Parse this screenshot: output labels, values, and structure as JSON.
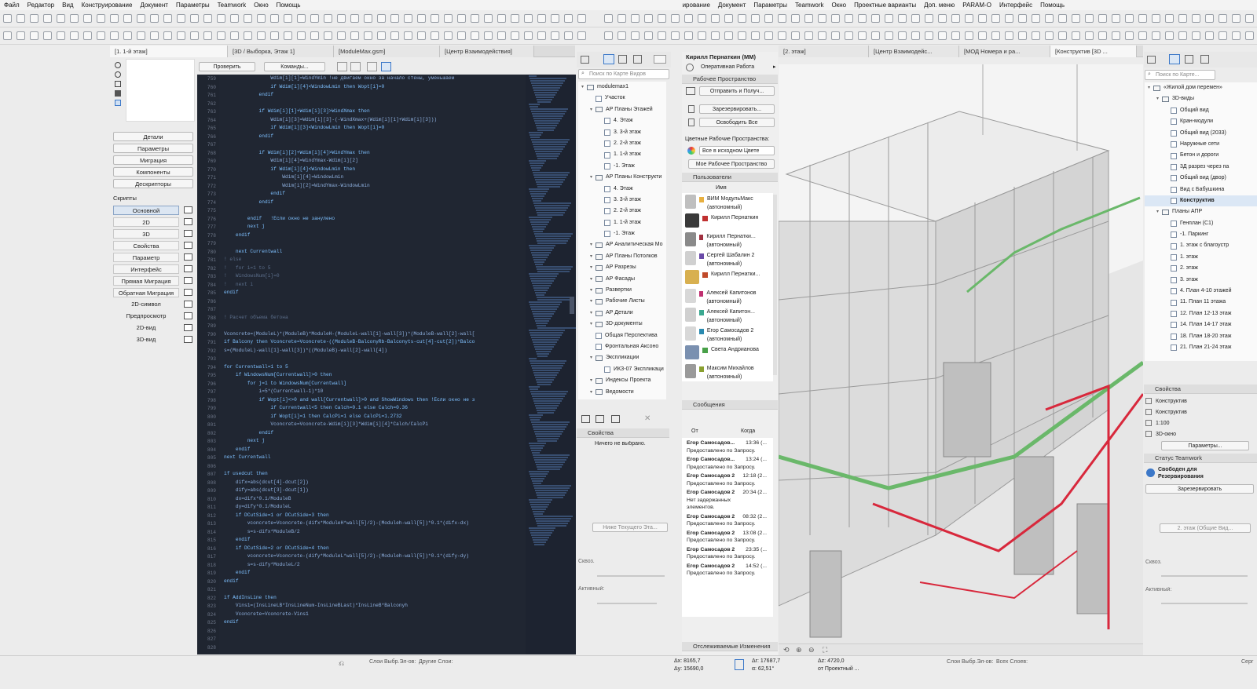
{
  "menu_left": [
    "Файл",
    "Редактор",
    "Вид",
    "Конструирование",
    "Документ",
    "Параметры",
    "Teamwork",
    "Окно",
    "Помощь"
  ],
  "menu_right": [
    "ирование",
    "Документ",
    "Параметры",
    "Teamwork",
    "Окно",
    "Проектные варианты",
    "Доп. меню",
    "PARAM-O",
    "Интерфейс",
    "Помощь"
  ],
  "left_tabs": [
    "[1. 1-й этаж]",
    "[3D / Выборка, Этаж 1]",
    "[ModuleMax.gsm]",
    "[Центр Взаимодействия]"
  ],
  "right_tabs": [
    "[2. этаж]",
    "[Центр Взаимодейс...",
    "[МОД Номера и ра...",
    "[Конструктив [3D ..."
  ],
  "gdl": {
    "check_button": "Проверить",
    "commands_button": "Команды...",
    "buttons": [
      "Детали",
      "Параметры",
      "Миграция",
      "Компоненты",
      "Дескрипторы"
    ],
    "scripts_label": "Скрипты",
    "scripts": [
      "Основной",
      "2D",
      "3D",
      "Свойства",
      "Параметр",
      "Интерфейс",
      "Прямая Миграция",
      "Обратная Миграция",
      "2D-символ",
      "Предпросмотр",
      "2D-вид",
      "3D-вид"
    ]
  },
  "code": {
    "line_numbers": [
      "759",
      "760",
      "761",
      "762",
      "763",
      "764",
      "765",
      "766",
      "767",
      "768",
      "769",
      "770",
      "771",
      "772",
      "773",
      "774",
      "775",
      "776",
      "777",
      "778",
      "779",
      "780",
      "781",
      "782",
      "783",
      "784",
      "785",
      "786",
      "787",
      "788",
      "789",
      "790",
      "791",
      "792",
      "793",
      "794",
      "795",
      "796",
      "797",
      "798",
      "799",
      "800",
      "801",
      "802",
      "803",
      "804",
      "805",
      "806",
      "807",
      "808",
      "809",
      "810",
      "811",
      "812",
      "813",
      "814",
      "815",
      "816",
      "817",
      "818",
      "819",
      "820",
      "821",
      "822",
      "823",
      "824",
      "825",
      "826",
      "827",
      "828"
    ],
    "lines": [
      "                Wdim[i][1]=WindYmin !не двигаем окно за начало стены, уменьшаем",
      "                if Wdim[i][4]<WindowLmin then Wopt[i]=0",
      "            endif",
      "",
      "            if Wdim[i][1]+Wdim[i][3]>WindXmax then",
      "                Wdim[i][3]=Wdim[i][3]-(-WindXmax+(Wdim[i][1]+Wdim[i][3]))",
      "                if Wdim[i][3]<WindowLmin then Wopt[i]=0",
      "            endif",
      "",
      "            if Wdim[i][2]+Wdim[i][4]>WindYmax then",
      "                Wdim[i][4]=WindYmax-Wdim[i][2]",
      "                if Wdim[i][4]<WindowLmin then",
      "                    Wdim[i][4]=WindowLmin",
      "                    Wdim[i][2]=WindYmax-WindowLmin",
      "                endif",
      "            endif",
      "",
      "        endif   !Если окно не занулено",
      "        next j",
      "    endif",
      "",
      "    next Currentwall",
      "! else",
      "!   for i=1 to 5",
      "!   WindowsNum[i]=0",
      "!   next i",
      "endif",
      "",
      "",
      "! Расчет объема бетона",
      "",
      "Vconcrete=(ModuleL)*(ModuleB)*ModuleH-(ModuleL-wall[1]-wall[3])*(ModuleB-wall[2]-wall[",
      "if Balcony then Vconcrete=Vconcrete-((ModuleB-BalconyRb-Balconyts-cut[4]-cut[2])*Balco",
      "s=(ModuleL)-wall[1]-wall[3])*((ModuleB)-wall[2]-wall[4])",
      "",
      "for Currentwall=1 to 5",
      "    if WindowsNum[Currentwall]>0 then",
      "        for j=1 to WindowsNum[Currentwall]",
      "            i=5*(Currentwall-1)*10",
      "            if Wopt[i]<>0 and wall[Currentwall]>0 and ShowWindows then !Если окно не з",
      "                if Currentwall<5 then Calch=0.1 else Calch=0.36",
      "                if Wopt[i]=1 then CalcPi=1 else CalcPi=1.2732",
      "                Vconcrete=Vconcrete-Wdim[i][3]*Wdim[i][4]*Calch/CalcPi",
      "            endif",
      "        next j",
      "    endif",
      "next Currentwall",
      "",
      "if usedcut then",
      "    difx=abs(dcut[4]-dcut[2])",
      "    dify=abs(dcut[3]-dcut[1])",
      "    dx=difx*0.1/ModuleB",
      "    dy=dify*0.1/ModuleL",
      "    if DCutSide=1 or DCutSide=3 then",
      "        vconcrete=Vconcrete-(difx*ModuleH*wall[5]/2)-(Moduleh-wall[5])*0.1*(difx-dx)",
      "        s=s-difx*ModuleB/2",
      "    endif",
      "    if DCutSide=2 or DCutSide=4 then",
      "        vconcrete=Vconcrete-(dify*ModuleL*wall[5]/2)-(Moduleh-wall[5])*0.1*(dify-dy)",
      "        s=s-dify*ModuleL/2",
      "    endif",
      "endif",
      "",
      "if AddInsLine then",
      "    Vins1=(InsLineLB*InsLineNum-InsLineBLast)*InsLineB*Balconyh",
      "    Vconcrete=Vconcrete-Vins1",
      "endif",
      "",
      ""
    ]
  },
  "navigator": {
    "search_placeholder": "Поиск по Карте Видов",
    "items": [
      {
        "label": "modulemax1",
        "indent": 0,
        "type": "folder"
      },
      {
        "label": "Участок",
        "indent": 1,
        "type": "view"
      },
      {
        "label": "АР Планы Этажей",
        "indent": 1,
        "type": "folder"
      },
      {
        "label": "4. Этаж",
        "indent": 2,
        "type": "view"
      },
      {
        "label": "3. 3-й этаж",
        "indent": 2,
        "type": "view"
      },
      {
        "label": "2. 2-й этаж",
        "indent": 2,
        "type": "view"
      },
      {
        "label": "1. 1-й этаж",
        "indent": 2,
        "type": "view"
      },
      {
        "label": "-1. Этаж",
        "indent": 2,
        "type": "view"
      },
      {
        "label": "АР Планы Конструкти",
        "indent": 1,
        "type": "folder"
      },
      {
        "label": "4. Этаж",
        "indent": 2,
        "type": "view"
      },
      {
        "label": "3. 3-й этаж",
        "indent": 2,
        "type": "view"
      },
      {
        "label": "2. 2-й этаж",
        "indent": 2,
        "type": "view"
      },
      {
        "label": "1. 1-й этаж",
        "indent": 2,
        "type": "view"
      },
      {
        "label": "-1. Этаж",
        "indent": 2,
        "type": "view"
      },
      {
        "label": "АР Аналитическая Мо",
        "indent": 1,
        "type": "folder"
      },
      {
        "label": "АР Планы Потолков",
        "indent": 1,
        "type": "folder"
      },
      {
        "label": "АР Разрезы",
        "indent": 1,
        "type": "folder"
      },
      {
        "label": "АР Фасады",
        "indent": 1,
        "type": "folder"
      },
      {
        "label": "Развертки",
        "indent": 1,
        "type": "folder"
      },
      {
        "label": "Рабочие Листы",
        "indent": 1,
        "type": "folder"
      },
      {
        "label": "АР Детали",
        "indent": 1,
        "type": "folder"
      },
      {
        "label": "3D-документы",
        "indent": 1,
        "type": "folder"
      },
      {
        "label": "Общая Перспектива",
        "indent": 1,
        "type": "view"
      },
      {
        "label": "Фронтальная Аксоно",
        "indent": 1,
        "type": "view"
      },
      {
        "label": "Экспликации",
        "indent": 1,
        "type": "folder"
      },
      {
        "label": "ИКЗ-07 Экспликаци",
        "indent": 2,
        "type": "view"
      },
      {
        "label": "Индексы Проекта",
        "indent": 1,
        "type": "folder"
      },
      {
        "label": "Ведомости",
        "indent": 1,
        "type": "folder"
      }
    ],
    "properties_header": "Свойства",
    "properties_empty": "Ничего не выбрано.",
    "layer_btn": "Ниже Текущего Эта...",
    "opacity_label": "Сквоз.",
    "active_label": "Активный:"
  },
  "teamwork": {
    "user": "Кирилл Пернаткин (ММ)",
    "mode": "Оперативная Работа",
    "workspace_header": "Рабочее Пространство",
    "send_receive": "Отправить и Получ...",
    "reserve": "Зарезервировать...",
    "release_all": "Освободить Все",
    "color_label": "Цветные Рабочие Пространства:",
    "color_option": "Все в исходном Цвете",
    "my_workspace": "Мое Рабочее Пространство",
    "users_header": "Пользователи",
    "name_col": "Имя",
    "users": [
      {
        "name": "ВИМ МодульМакс (автономный)",
        "color": "#e8b040",
        "avatar": "#bfbfbf"
      },
      {
        "name": "Кирилл Пернаткин",
        "color": "#c03030",
        "avatar": "#3a3a3a"
      },
      {
        "name": "Кирилл Пернатки... (автономный)",
        "color": "#a03040",
        "avatar": "#8a8a8a"
      },
      {
        "name": "Сергей Шабалин 2 (автономный)",
        "color": "#6a4aa8",
        "avatar": "#d0d0d0"
      },
      {
        "name": "Кирилл Пернатки...",
        "color": "#c04a2a",
        "avatar": "#d8b050"
      },
      {
        "name": "Алексей Капитонов (автономный)",
        "color": "#c03070",
        "avatar": "#d8d8d8"
      },
      {
        "name": "Алексей Капитон... (автономный)",
        "color": "#3aa890",
        "avatar": "#d0d0d0"
      },
      {
        "name": "Егор Самосадов 2 (автономный)",
        "color": "#2a8ab0",
        "avatar": "#d8d8d8"
      },
      {
        "name": "Света Андрианова",
        "color": "#48a048",
        "avatar": "#7a90b0"
      },
      {
        "name": "Максим Михайлов (автономный)",
        "color": "#8aa030",
        "avatar": "#9a9a9a"
      }
    ],
    "messages_header": "Сообщения",
    "from_col": "От",
    "when_col": "Когда",
    "messages": [
      {
        "from": "Егор Самосадов...",
        "time": "13:36 (...",
        "text": "Предоставлено по Запросу."
      },
      {
        "from": "Егор Самосадов...",
        "time": "13:24 (...",
        "text": "Предоставлено по Запросу."
      },
      {
        "from": "Егор Самосадов 2",
        "time": "12:18 (2...",
        "text": "Предоставлено по Запросу."
      },
      {
        "from": "Егор Самосадов 2",
        "time": "20:34 (2...",
        "text": "Нет задержанных элементов."
      },
      {
        "from": "Егор Самосадов 2",
        "time": "08:32 (2...",
        "text": "Предоставлено по Запросу."
      },
      {
        "from": "Егор Самосадов 2",
        "time": "13:08 (2...",
        "text": "Предоставлено по Запросу."
      },
      {
        "from": "Егор Самосадов 2",
        "time": "23:35 (...",
        "text": "Предоставлено по Запросу."
      },
      {
        "from": "Егор Самосадов 2",
        "time": "14:52 (...",
        "text": "Предоставлено по Запросу."
      }
    ],
    "tracked_header": "Отслеживаемые Изменения"
  },
  "right_nav": {
    "search_placeholder": "Поиск по Карте...",
    "items": [
      {
        "label": "«Жилой дом перемен»",
        "indent": 0,
        "type": "folder"
      },
      {
        "label": "3D-виды",
        "indent": 1,
        "type": "folder"
      },
      {
        "label": "Общий вид",
        "indent": 2,
        "type": "view"
      },
      {
        "label": "Кран-модули",
        "indent": 2,
        "type": "view"
      },
      {
        "label": "Общий вид (2033)",
        "indent": 2,
        "type": "view"
      },
      {
        "label": "Наружные сети",
        "indent": 2,
        "type": "view"
      },
      {
        "label": "Бетон и дороги",
        "indent": 2,
        "type": "view"
      },
      {
        "label": "3Д разрез через па",
        "indent": 2,
        "type": "view"
      },
      {
        "label": "Общий вид (двор)",
        "indent": 2,
        "type": "view"
      },
      {
        "label": "Вид с Бабушкина",
        "indent": 2,
        "type": "view"
      },
      {
        "label": "Конструктив",
        "indent": 2,
        "type": "view",
        "selected": true
      },
      {
        "label": "Планы АПР",
        "indent": 1,
        "type": "folder"
      },
      {
        "label": "Генплан (С1)",
        "indent": 2,
        "type": "view"
      },
      {
        "label": "-1. Паркинг",
        "indent": 2,
        "type": "view"
      },
      {
        "label": "1. этаж с благоустр",
        "indent": 2,
        "type": "view"
      },
      {
        "label": "1. этаж",
        "indent": 2,
        "type": "view"
      },
      {
        "label": "2. этаж",
        "indent": 2,
        "type": "view"
      },
      {
        "label": "3. этаж",
        "indent": 2,
        "type": "view"
      },
      {
        "label": "4. План 4-10 этажей",
        "indent": 2,
        "type": "view"
      },
      {
        "label": "11. План 11 этажа",
        "indent": 2,
        "type": "view"
      },
      {
        "label": "12. План 12-13 этаж",
        "indent": 2,
        "type": "view"
      },
      {
        "label": "14. План 14-17 этаж",
        "indent": 2,
        "type": "view"
      },
      {
        "label": "18. План 18-20 этаж",
        "indent": 2,
        "type": "view"
      },
      {
        "label": "21. План 21-24 этаж",
        "indent": 2,
        "type": "view"
      }
    ],
    "properties_header": "Свойства",
    "props": [
      "Конструктив",
      "Конструктив",
      "1:100",
      "3D-окно"
    ],
    "params_btn": "Параметры...",
    "status_header": "Статус Teamwork",
    "status_text": "Свободен для Резервирования",
    "reserve_btn": "Зарезервировать",
    "layer_btn": "2. этаж (Общие Вид...",
    "opacity_label": "Сквоз.",
    "active_label": "Активный:"
  },
  "status": {
    "ax": "Δx: 8165,7",
    "ay": "Δy: 15690,0",
    "ar": "Δr: 17687,7",
    "aa": "α: 62,51°",
    "az": "Δz: 4720,0",
    "from": "от Проектный ...",
    "left_a": "Слои Выбр.Эл-ов:",
    "left_b": "Другие Слои:",
    "right_a": "Слои Выбр.Эл-ов:",
    "right_b": "Всех Слоев:",
    "right_c": "Серг"
  },
  "colors": {
    "accent": "#3c78c8",
    "editor_bg": "#202632",
    "pipe_red": "#d8283c",
    "stair_green": "#6ab86a"
  }
}
